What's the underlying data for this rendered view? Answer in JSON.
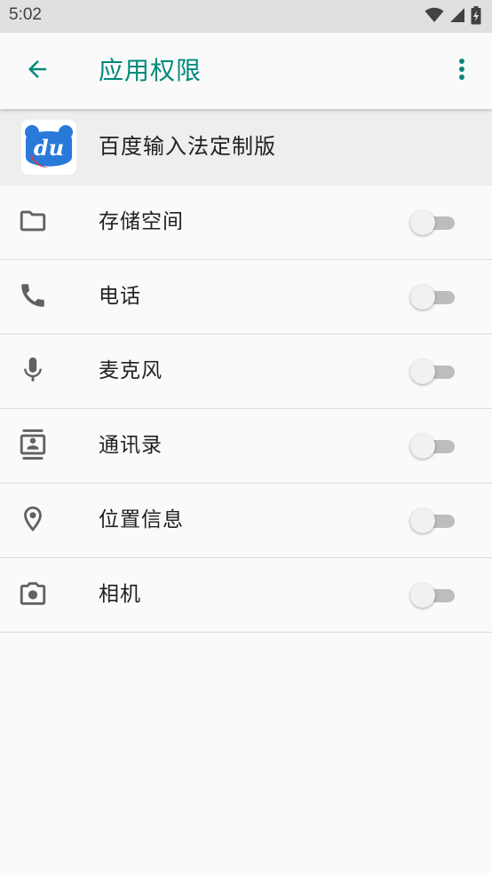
{
  "status_bar": {
    "time": "5:02"
  },
  "app_bar": {
    "title": "应用权限"
  },
  "app_header": {
    "app_name": "百度输入法定制版",
    "icon_text": "du"
  },
  "permissions": [
    {
      "label": "存储空间",
      "icon": "folder-icon",
      "enabled": false
    },
    {
      "label": "电话",
      "icon": "phone-icon",
      "enabled": false
    },
    {
      "label": "麦克风",
      "icon": "microphone-icon",
      "enabled": false
    },
    {
      "label": "通讯录",
      "icon": "contacts-icon",
      "enabled": false
    },
    {
      "label": "位置信息",
      "icon": "location-icon",
      "enabled": false
    },
    {
      "label": "相机",
      "icon": "camera-icon",
      "enabled": false
    }
  ],
  "colors": {
    "accent": "#00897b",
    "icon_gray": "#616161",
    "app_icon_blue": "#2979d9"
  }
}
